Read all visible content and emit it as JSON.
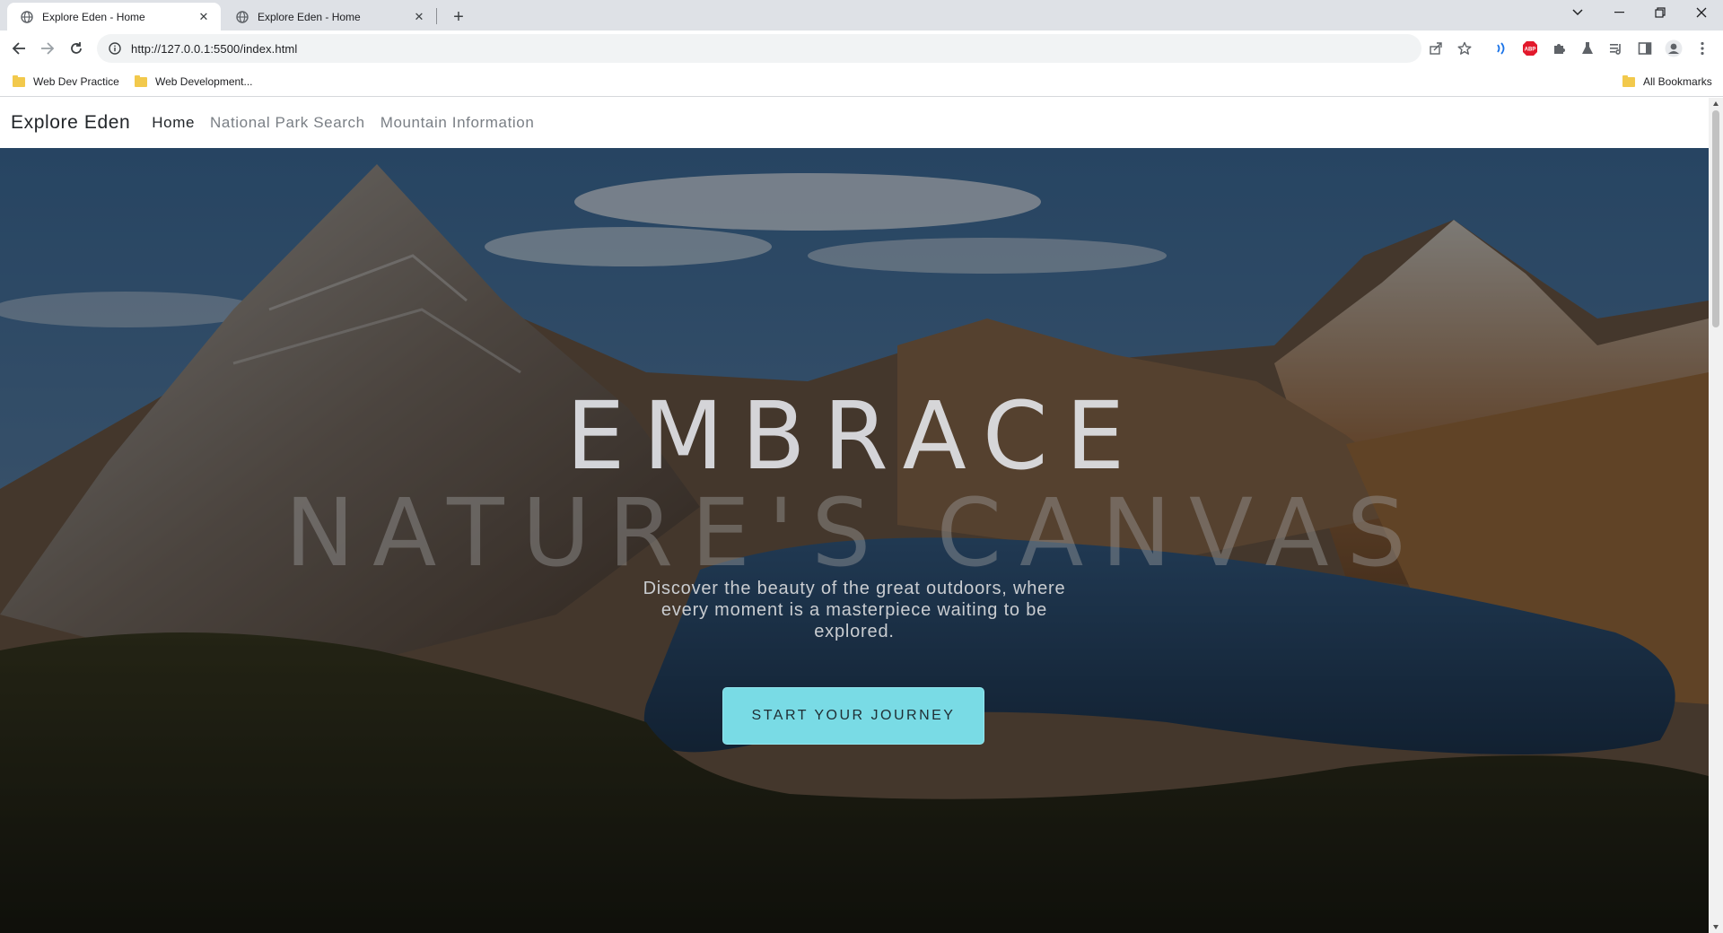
{
  "browser": {
    "tabs": [
      {
        "title": "Explore Eden - Home",
        "active": true
      },
      {
        "title": "Explore Eden - Home",
        "active": false
      }
    ],
    "url": "http://127.0.0.1:5500/index.html",
    "bookmarks": [
      {
        "label": "Web Dev Practice"
      },
      {
        "label": "Web Development..."
      }
    ],
    "all_bookmarks_label": "All Bookmarks",
    "extension_icons": [
      "speechify-icon",
      "adblock-plus-icon",
      "extensions-puzzle-icon",
      "labs-flask-icon",
      "reading-list-icon",
      "side-panel-icon",
      "profile-avatar-icon",
      "kebab-menu-icon"
    ],
    "colors": {
      "tabstrip": "#dee1e6",
      "omnibox": "#f1f3f4",
      "folder": "#f2c94c"
    }
  },
  "page": {
    "brand": "Explore Eden",
    "nav": [
      {
        "label": "Home",
        "active": true
      },
      {
        "label": "National Park Search",
        "active": false
      },
      {
        "label": "Mountain Information",
        "active": false
      }
    ],
    "hero": {
      "headline_line1": "EMBRACE",
      "headline_line2": "NATURE'S CANVAS",
      "tagline": "Discover the beauty of the great outdoors, where every moment is a masterpiece waiting to be explored.",
      "cta_label": "START YOUR JOURNEY",
      "colors": {
        "cta": "#79dbe5",
        "cta_text": "#1f2d33"
      }
    }
  }
}
